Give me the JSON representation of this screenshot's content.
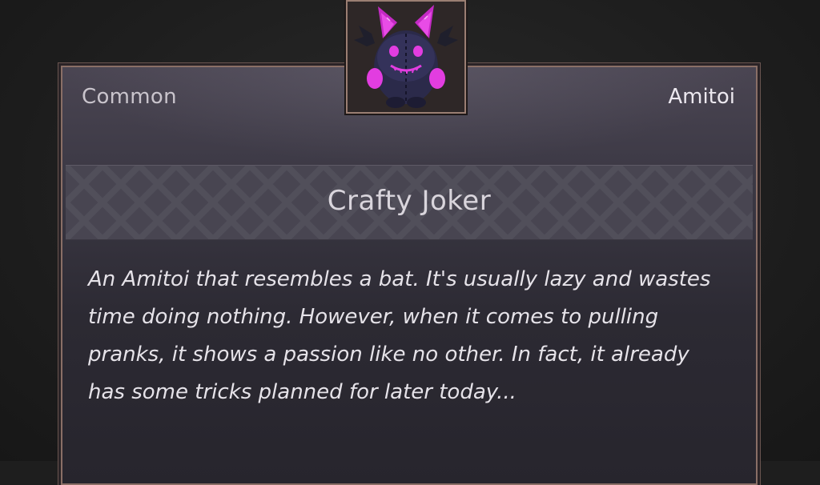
{
  "card": {
    "rarity": "Common",
    "category": "Amitoi",
    "name": "Crafty Joker",
    "description": "An Amitoi that resembles a bat. It's usually lazy and wastes time doing nothing. However, when it comes to pulling pranks, it shows a passion like no other. In fact, it already has some tricks planned for later today..."
  },
  "portrait": {
    "icon": "bat-plush-icon"
  },
  "colors": {
    "plush_body": "#2b2a4a",
    "plush_accent": "#e23de0",
    "frame_border": "#9a7e72"
  }
}
